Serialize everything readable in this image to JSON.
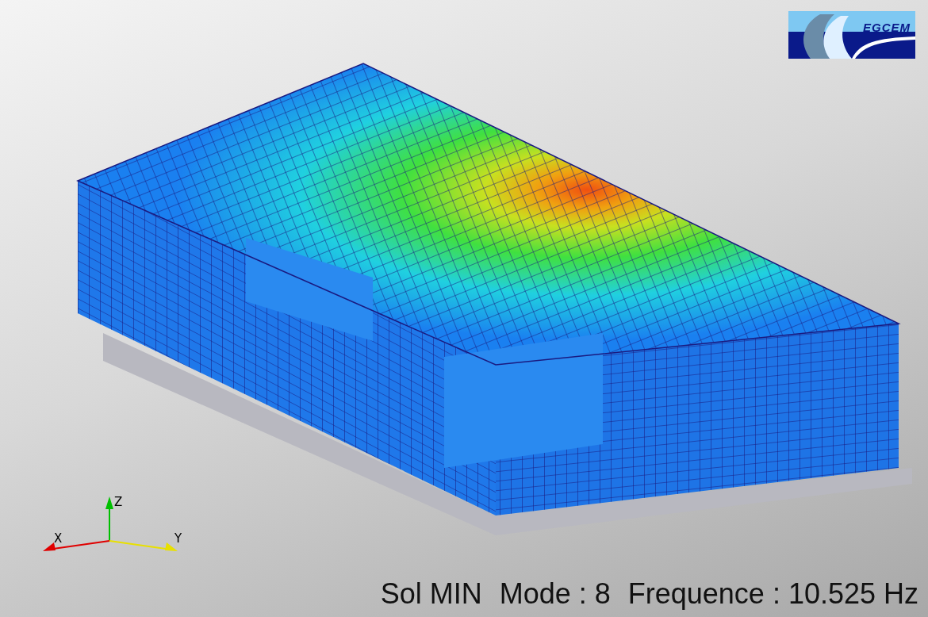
{
  "logo": {
    "text": "EGCEM"
  },
  "axes": [
    {
      "kind": "z",
      "label": "Z",
      "color": "#00c000"
    },
    {
      "kind": "x",
      "label": "X",
      "color": "#e00000"
    },
    {
      "kind": "y",
      "label": "Y",
      "color": "#e8e000"
    }
  ],
  "caption": [
    "Sol MIN",
    "Mode : 8",
    "Frequence : 10.525 Hz"
  ]
}
